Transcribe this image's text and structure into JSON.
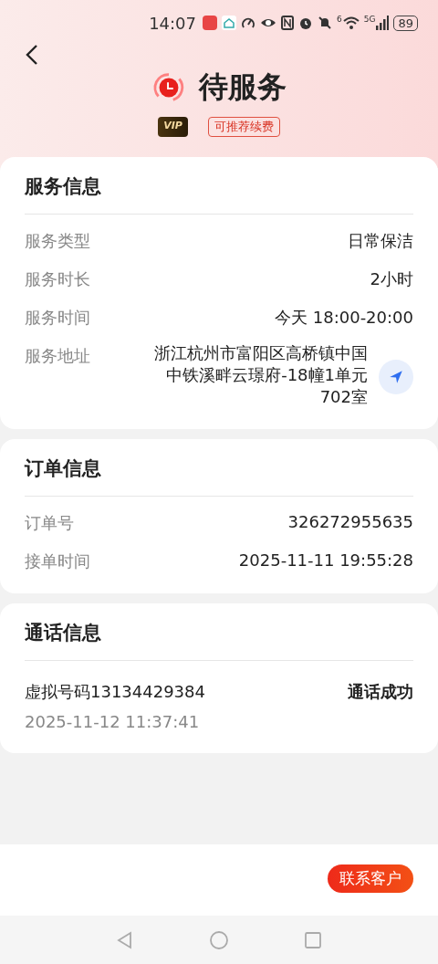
{
  "status_bar": {
    "time": "14:07",
    "wifi_label": "6",
    "network": "5G",
    "battery": "89"
  },
  "header": {
    "title": "待服务",
    "badges": [
      {
        "kind": "vip",
        "label": "VIP"
      },
      {
        "kind": "outline",
        "label": "可推荐续费"
      }
    ]
  },
  "sections": [
    {
      "title": "服务信息",
      "rows": [
        {
          "label": "服务类型",
          "value": "日常保洁",
          "kind": "plain"
        },
        {
          "label": "服务时长",
          "value": "2小时",
          "kind": "plain"
        },
        {
          "label": "服务时间",
          "value": "今天 18:00-20:00",
          "kind": "plain"
        },
        {
          "label": "服务地址",
          "value": "浙江杭州市富阳区高桥镇中国中铁溪畔云璟府-18幢1单元702室",
          "kind": "address"
        }
      ]
    },
    {
      "title": "订单信息",
      "rows": [
        {
          "label": "订单号",
          "value": "326272955635",
          "kind": "plain"
        },
        {
          "label": "接单时间",
          "value": "2025-11-11 19:55:28",
          "kind": "plain"
        }
      ]
    },
    {
      "title": "通话信息",
      "calls": [
        {
          "number": "虚拟号码13134429384",
          "result": "通话成功",
          "time": "2025-11-12 11:37:41"
        }
      ]
    }
  ],
  "action_button": "联系客户"
}
